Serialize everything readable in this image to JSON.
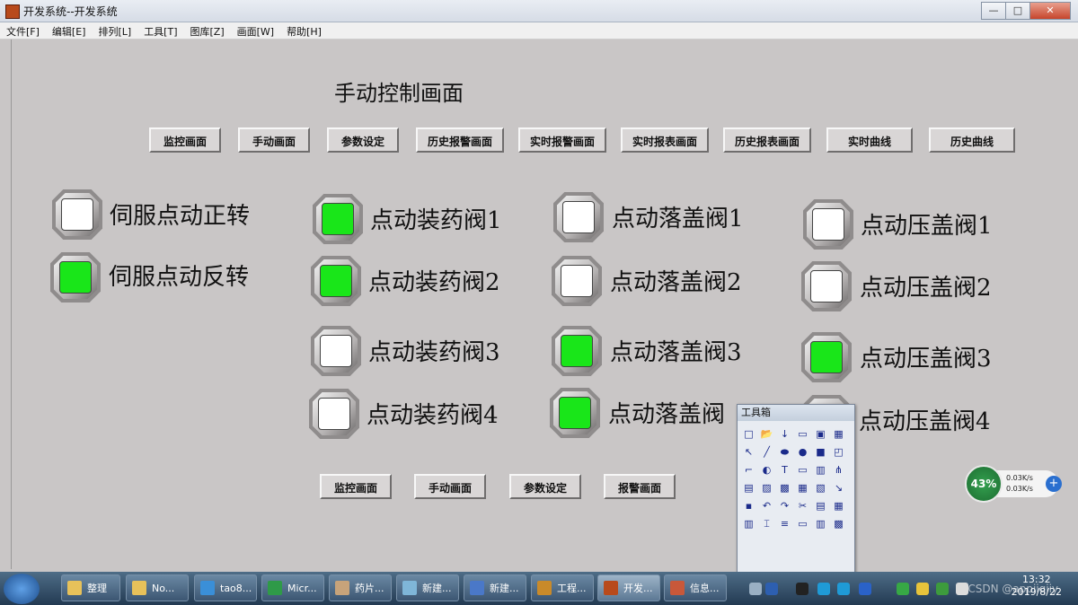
{
  "window": {
    "title": "开发系统--开发系统"
  },
  "window_buttons": {
    "minimize": "—",
    "maximize": "□",
    "close": "✕"
  },
  "menu": [
    "文件[F]",
    "编辑[E]",
    "排列[L]",
    "工具[T]",
    "图库[Z]",
    "画面[W]",
    "帮助[H]"
  ],
  "screen": {
    "heading": "手动控制画面"
  },
  "top_nav": [
    "监控画面",
    "手动画面",
    "参数设定",
    "历史报警画面",
    "实时报警画面",
    "实时报表画面",
    "历史报表画面",
    "实时曲线",
    "历史曲线"
  ],
  "lamps": [
    {
      "label": "伺服点动正转",
      "state": "off"
    },
    {
      "label": "伺服点动反转",
      "state": "on"
    },
    {
      "label": "点动装药阀1",
      "state": "on"
    },
    {
      "label": "点动装药阀2",
      "state": "on"
    },
    {
      "label": "点动装药阀3",
      "state": "off"
    },
    {
      "label": "点动装药阀4",
      "state": "off"
    },
    {
      "label": "点动落盖阀1",
      "state": "off"
    },
    {
      "label": "点动落盖阀2",
      "state": "off"
    },
    {
      "label": "点动落盖阀3",
      "state": "on"
    },
    {
      "label": "点动落盖阀",
      "state": "on"
    },
    {
      "label": "点动压盖阀1",
      "state": "off"
    },
    {
      "label": "点动压盖阀2",
      "state": "off"
    },
    {
      "label": "点动压盖阀3",
      "state": "on"
    },
    {
      "label": "点动压盖阀4",
      "state": "off"
    }
  ],
  "colors": {
    "lamp_on": "#19e619",
    "lamp_off": "#ffffff"
  },
  "bottom_nav": [
    "监控画面",
    "手动画面",
    "参数设定",
    "报警画面"
  ],
  "toolbox": {
    "title": "工具箱",
    "tools": [
      "□",
      "📂",
      "↓",
      "▭",
      "▣",
      "▦",
      "↖",
      "╱",
      "⬬",
      "●",
      "■",
      "◰",
      "⌐",
      "◐",
      "T",
      "▭",
      "▥",
      "⋔",
      "▤",
      "▨",
      "▩",
      "▦",
      "▧",
      "↘",
      "▪",
      "↶",
      "↷",
      "✂",
      "▤",
      "▦",
      "▥",
      "⌶",
      "≡",
      "▭",
      "▥",
      "▩"
    ]
  },
  "net": {
    "percent": "43%",
    "up": "0.03K/s",
    "down": "0.03K/s",
    "plus": "+"
  },
  "taskbar": {
    "tasks": [
      "整理",
      "No...",
      "tao8...",
      "Micr...",
      "药片...",
      "新建...",
      "新建...",
      "工程...",
      "开发...",
      "信息..."
    ],
    "time": "13:32",
    "date": "2019/8/22",
    "watermark": "CSDN @appiiqiiy"
  }
}
